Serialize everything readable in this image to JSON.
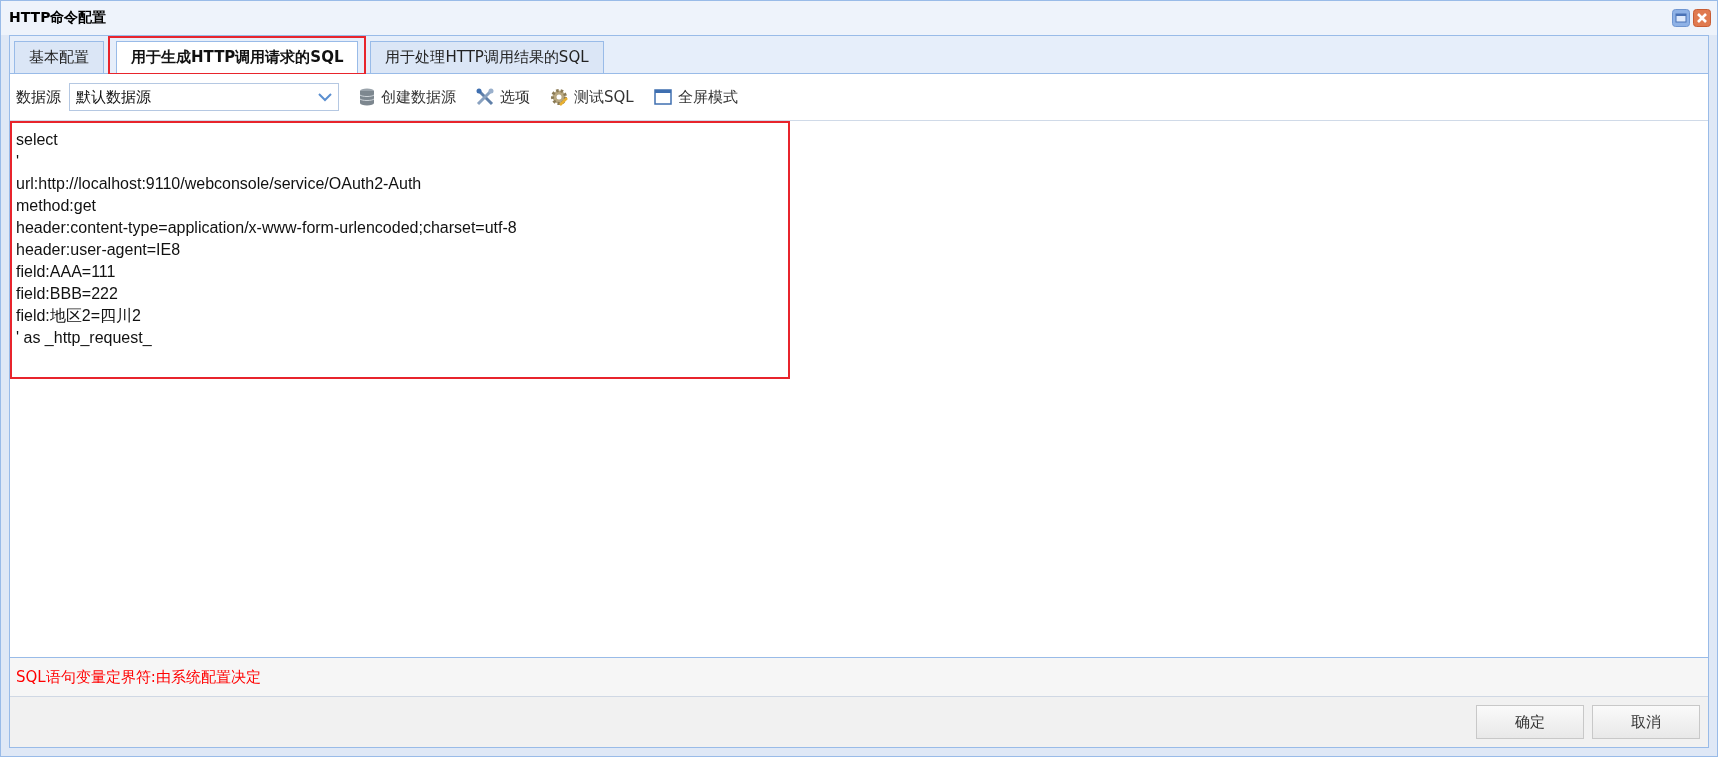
{
  "window": {
    "title": "HTTP命令配置"
  },
  "tabs": [
    {
      "label": "基本配置",
      "selected": false,
      "highlighted": false
    },
    {
      "label": "用于生成HTTP调用请求的SQL",
      "selected": true,
      "highlighted": true
    },
    {
      "label": "用于处理HTTP调用结果的SQL",
      "selected": false,
      "highlighted": false
    }
  ],
  "toolbar": {
    "datasource_label": "数据源",
    "datasource_value": "默认数据源",
    "buttons": [
      {
        "kind": "database",
        "label": "创建数据源"
      },
      {
        "kind": "tools",
        "label": "选项"
      },
      {
        "kind": "gear",
        "label": "测试SQL"
      },
      {
        "kind": "window",
        "label": "全屏模式"
      }
    ]
  },
  "editor": {
    "highlighted": true,
    "lines": [
      "select",
      "'",
      "url:http://localhost:9110/webconsole/service/OAuth2-Auth",
      "method:get",
      "header:content-type=application/x-www-form-urlencoded;charset=utf-8",
      "header:user-agent=IE8",
      "field:AAA=111",
      "field:BBB=222",
      "field:地区2=四川2",
      "' as _http_request_"
    ]
  },
  "hint": "SQL语句变量定界符:由系统配置决定",
  "buttons": [
    "确定",
    "取消"
  ]
}
